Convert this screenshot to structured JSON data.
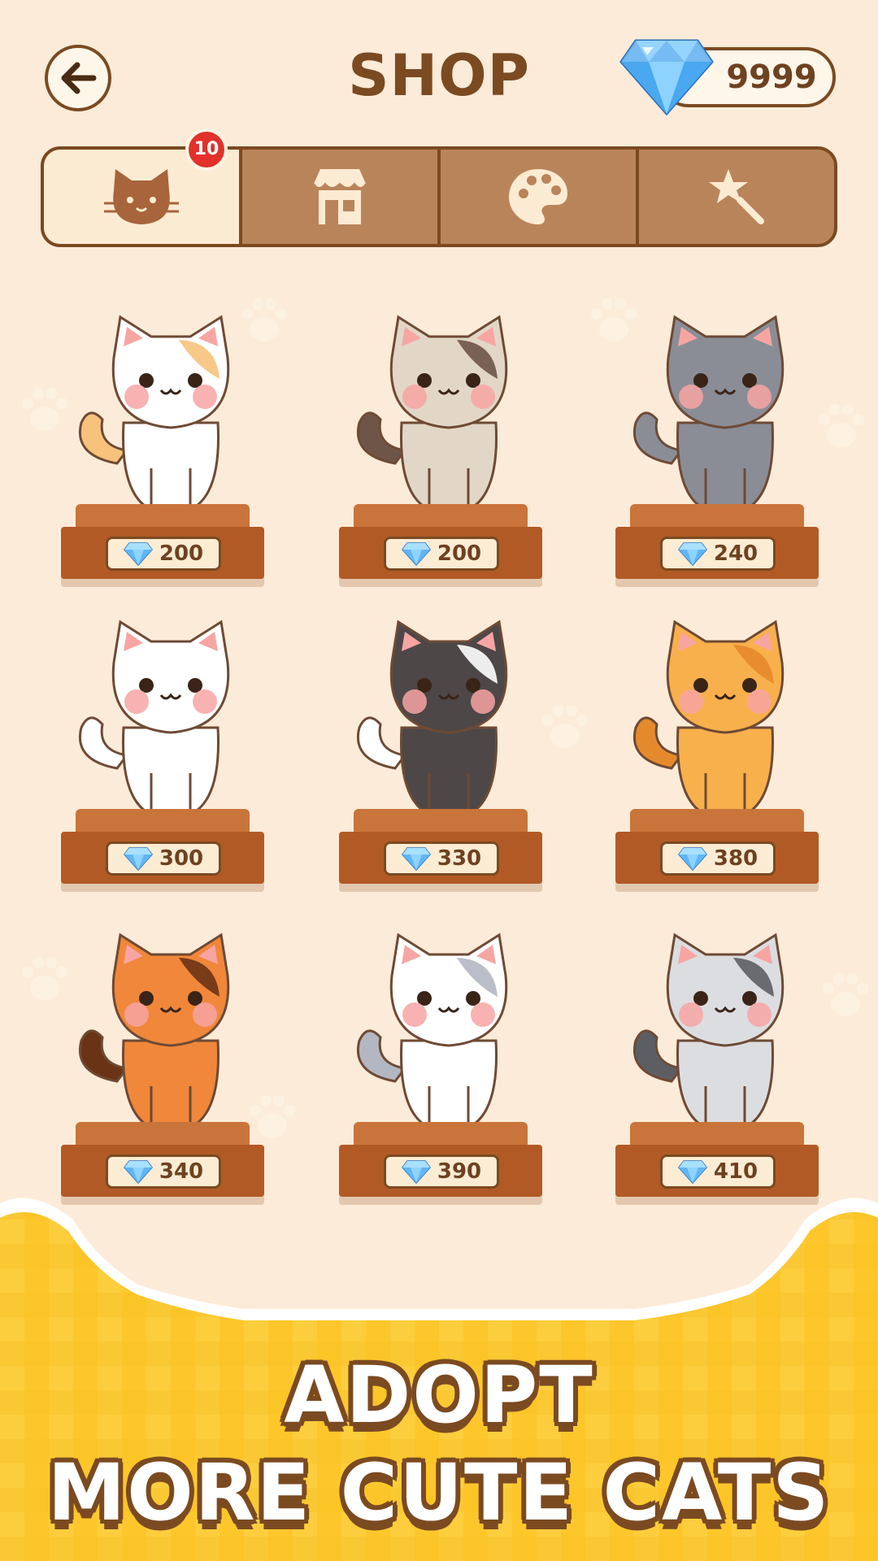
{
  "header": {
    "title": "SHOP",
    "gem_balance": "9999",
    "back_icon": "arrow-left-icon"
  },
  "tabs": [
    {
      "icon": "cat-face-icon",
      "active": true,
      "badge": "10"
    },
    {
      "icon": "storefront-icon",
      "active": false
    },
    {
      "icon": "palette-icon",
      "active": false
    },
    {
      "icon": "magic-wand-icon",
      "active": false
    }
  ],
  "cats": [
    {
      "price": "200",
      "body": "#ffffff",
      "accent": "#f7c27c"
    },
    {
      "price": "200",
      "body": "#e2d7c6",
      "accent": "#6e5548"
    },
    {
      "price": "240",
      "body": "#8a8d96",
      "accent": "#8a8d96"
    },
    {
      "price": "300",
      "body": "#ffffff",
      "accent": "#ffffff"
    },
    {
      "price": "330",
      "body": "#4d4747",
      "accent": "#ffffff"
    },
    {
      "price": "380",
      "body": "#f8b04c",
      "accent": "#e58a2c"
    },
    {
      "price": "340",
      "body": "#f0873a",
      "accent": "#6b3315"
    },
    {
      "price": "390",
      "body": "#ffffff",
      "accent": "#b3b7c2"
    },
    {
      "price": "410",
      "body": "#dcdde0",
      "accent": "#5d5e63"
    }
  ],
  "banner": {
    "line1": "ADOPT",
    "line2": "MORE CUTE CATS"
  },
  "colors": {
    "background": "#fcebd8",
    "brown": "#7b4a21",
    "pedestal": "#b25a25",
    "banner_yellow": "#fdc72b",
    "gem_blue": "#4aa8f0"
  }
}
